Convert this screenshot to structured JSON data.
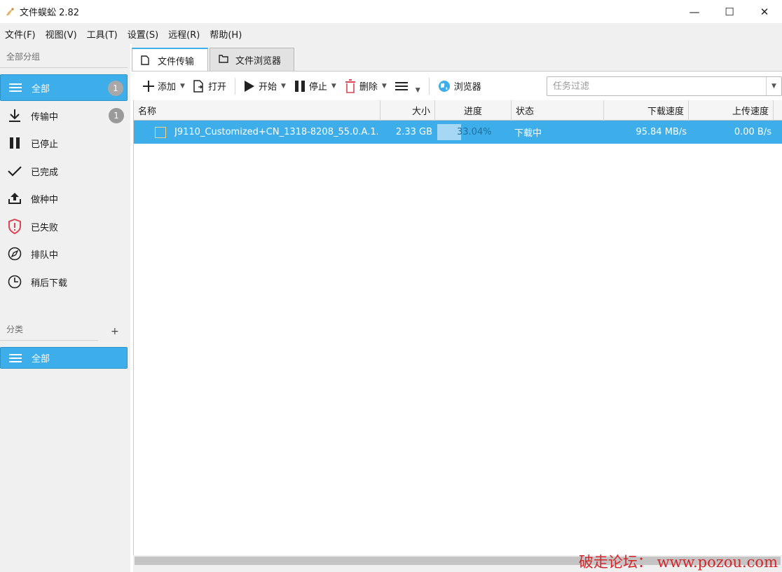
{
  "window": {
    "title": "文件蜈蚣 2.82",
    "controls": {
      "minimize": "—",
      "maximize": "☐",
      "close": "✕"
    }
  },
  "menu": [
    "文件(F)",
    "视图(V)",
    "工具(T)",
    "设置(S)",
    "远程(R)",
    "帮助(H)"
  ],
  "sidebar": {
    "groups_label": "全部分组",
    "items": [
      {
        "label": "全部",
        "icon": "list-icon",
        "badge": "1",
        "active": true
      },
      {
        "label": "传输中",
        "icon": "download-arrow-icon",
        "badge": "1",
        "active": false
      },
      {
        "label": "已停止",
        "icon": "pause-icon",
        "badge": "",
        "active": false
      },
      {
        "label": "已完成",
        "icon": "checkmark-icon",
        "badge": "",
        "active": false
      },
      {
        "label": "做种中",
        "icon": "upload-icon",
        "badge": "",
        "active": false
      },
      {
        "label": "已失败",
        "icon": "error-shield-icon",
        "badge": "",
        "active": false
      },
      {
        "label": "排队中",
        "icon": "compass-icon",
        "badge": "",
        "active": false
      },
      {
        "label": "稍后下载",
        "icon": "clock-icon",
        "badge": "",
        "active": false
      }
    ],
    "category_label": "分类",
    "add_category": "+",
    "categories": [
      {
        "label": "全部",
        "icon": "list-icon",
        "active": true
      }
    ]
  },
  "tabs": [
    {
      "label": "文件传输",
      "icon": "file-icon",
      "active": true
    },
    {
      "label": "文件浏览器",
      "icon": "folder-icon",
      "active": false
    }
  ],
  "toolbar": {
    "add": "添加",
    "open": "打开",
    "start": "开始",
    "stop": "停止",
    "delete": "删除",
    "browser": "浏览器",
    "filter_placeholder": "任务过滤"
  },
  "table": {
    "columns": [
      "名称",
      "大小",
      "进度",
      "状态",
      "下载速度",
      "上传速度"
    ],
    "rows": [
      {
        "name": "J9110_Customized+CN_1318-8208_55.0.A.1...",
        "size": "2.33 GB",
        "progress_text": "33.04%",
        "progress": 33.04,
        "status": "下载中",
        "download_speed": "95.84 MB/s",
        "upload_speed": "0.00 B/s",
        "selected": true
      }
    ]
  },
  "watermark": "破走论坛： www.pozou.com",
  "colors": {
    "accent": "#3daee9",
    "progress_fill": "#a6d8f5",
    "delete_red": "#da4453",
    "badge_gray": "#9a9a9a"
  }
}
